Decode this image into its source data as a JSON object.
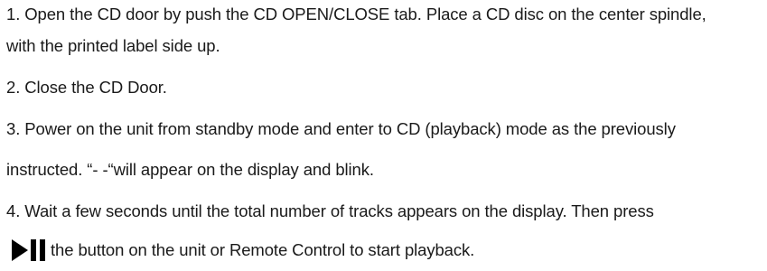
{
  "instructions": {
    "step1_line1": "1. Open the CD door by push the CD OPEN/CLOSE tab. Place a CD disc on the center spindle,",
    "step1_line2": "with the printed label side up.",
    "step2": "2. Close the CD Door.",
    "step3_line1": "3. Power on the unit from standby mode and enter to CD (playback) mode as the previously",
    "step3_line2": "instructed. “- -“will appear on the display and blink.",
    "step4_line1": "4. Wait a few seconds until the total number of tracks appears on the display. Then press",
    "step4_line2": "the button on the unit or Remote Control to start playback.",
    "step4_icon": "play-pause-icon"
  }
}
